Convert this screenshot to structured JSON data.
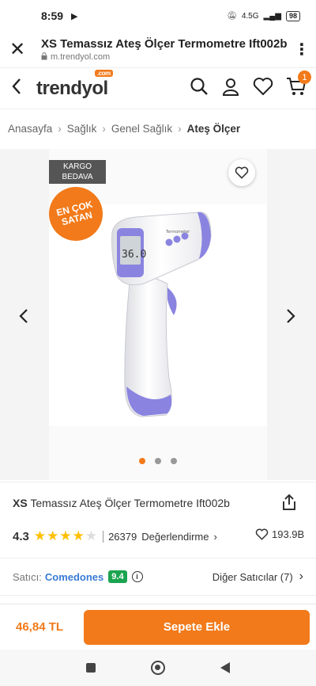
{
  "status_bar": {
    "time": "8:59",
    "network": "4.5G",
    "battery": "98"
  },
  "browser": {
    "page_title": "XS Temassız Ateş Ölçer Termometre Ift002b",
    "url": "m.trendyol.com"
  },
  "header": {
    "logo": "trendyol",
    "logo_tag": ".com",
    "cart_count": "1"
  },
  "breadcrumb": {
    "items": [
      "Anasayfa",
      "Sağlık",
      "Genel Sağlık",
      "Ateş Ölçer"
    ]
  },
  "gallery": {
    "badge_cargo_line1": "KARGO",
    "badge_cargo_line2": "BEDAVA",
    "badge_best_line1": "EN ÇOK",
    "badge_best_line2": "SATAN",
    "device_brand": "Termometer",
    "display_value": "36.0",
    "active_index": 0,
    "total_images": 3
  },
  "product": {
    "brand": "XS",
    "name": "Temassız Ateş Ölçer Termometre Ift002b",
    "rating": "4.3",
    "rating_fraction": 0.86,
    "review_count": "26379",
    "review_label": "Değerlendirme",
    "favorites": "193.9B"
  },
  "seller": {
    "label": "Satıcı:",
    "name": "Comedones",
    "score": "9.4",
    "others_label": "Diğer Satıcılar (7)"
  },
  "buy": {
    "price": "46,84 TL",
    "add_to_cart": "Sepete Ekle"
  },
  "colors": {
    "brand_orange": "#f27a1a",
    "seller_blue": "#3a7bd5",
    "score_green": "#1ba44f",
    "device_purple": "#8a84e0"
  }
}
